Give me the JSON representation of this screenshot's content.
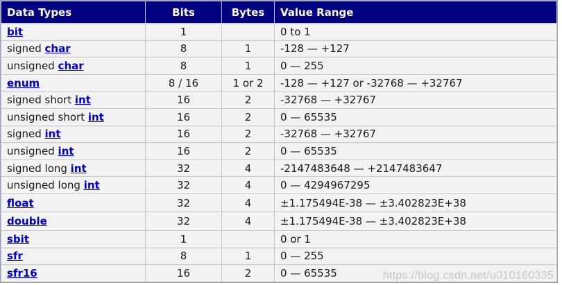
{
  "header": {
    "col_type": "Data Types",
    "col_bits": "Bits",
    "col_bytes": "Bytes",
    "col_range": "Value Range"
  },
  "rows": [
    {
      "prefix": "",
      "keyword": "bit",
      "bits": "1",
      "bytes": "",
      "range": "0 to 1"
    },
    {
      "prefix": "signed ",
      "keyword": "char",
      "bits": "8",
      "bytes": "1",
      "range": "-128 — +127"
    },
    {
      "prefix": "unsigned ",
      "keyword": "char",
      "bits": "8",
      "bytes": "1",
      "range": "0 — 255"
    },
    {
      "prefix": "",
      "keyword": "enum",
      "bits": "8 / 16",
      "bytes": "1 or 2",
      "range": "-128 — +127 or -32768 — +32767"
    },
    {
      "prefix": "signed short ",
      "keyword": "int",
      "bits": "16",
      "bytes": "2",
      "range": "-32768 — +32767"
    },
    {
      "prefix": "unsigned short ",
      "keyword": "int",
      "bits": "16",
      "bytes": "2",
      "range": "0 — 65535"
    },
    {
      "prefix": "signed ",
      "keyword": "int",
      "bits": "16",
      "bytes": "2",
      "range": "-32768 — +32767"
    },
    {
      "prefix": "unsigned ",
      "keyword": "int",
      "bits": "16",
      "bytes": "2",
      "range": "0 — 65535"
    },
    {
      "prefix": "signed long ",
      "keyword": "int",
      "bits": "32",
      "bytes": "4",
      "range": "-2147483648 — +2147483647"
    },
    {
      "prefix": "unsigned long ",
      "keyword": "int",
      "bits": "32",
      "bytes": "4",
      "range": "0 — 4294967295"
    },
    {
      "prefix": "",
      "keyword": "float",
      "bits": "32",
      "bytes": "4",
      "range": "±1.175494E-38 — ±3.402823E+38"
    },
    {
      "prefix": "",
      "keyword": "double",
      "bits": "32",
      "bytes": "4",
      "range": "±1.175494E-38 — ±3.402823E+38"
    },
    {
      "prefix": "",
      "keyword": "sbit",
      "bits": "1",
      "bytes": "",
      "range": "0 or 1"
    },
    {
      "prefix": "",
      "keyword": "sfr",
      "bits": "8",
      "bytes": "1",
      "range": "0 — 255"
    },
    {
      "prefix": "",
      "keyword": "sfr16",
      "bits": "16",
      "bytes": "2",
      "range": "0 — 65535"
    }
  ],
  "watermark": "https://blog.csdn.net/u010160335",
  "colors": {
    "header_bg": "#000080",
    "header_text": "#ffffff",
    "link": "#0000cc",
    "row_bg": "#f2f2f2"
  }
}
